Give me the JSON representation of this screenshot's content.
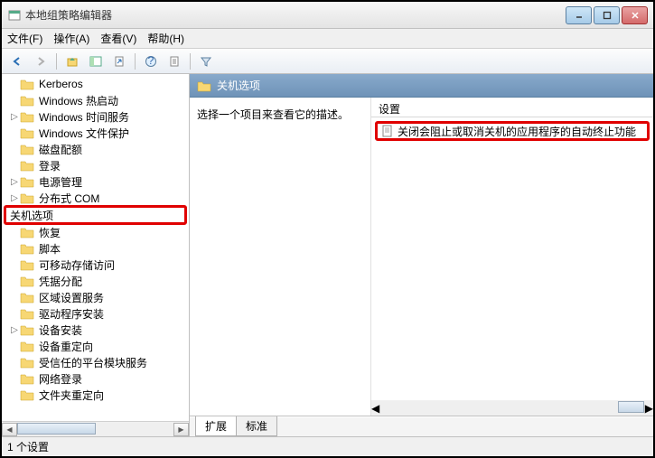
{
  "window": {
    "title": "本地组策略编辑器"
  },
  "menu": {
    "file": "文件(F)",
    "action": "操作(A)",
    "view": "查看(V)",
    "help": "帮助(H)"
  },
  "tree": {
    "items": [
      {
        "label": "Kerberos",
        "exp": ""
      },
      {
        "label": "Windows 热启动",
        "exp": ""
      },
      {
        "label": "Windows 时间服务",
        "exp": "▷"
      },
      {
        "label": "Windows 文件保护",
        "exp": ""
      },
      {
        "label": "磁盘配额",
        "exp": ""
      },
      {
        "label": "登录",
        "exp": ""
      },
      {
        "label": "电源管理",
        "exp": "▷"
      },
      {
        "label": "分布式 COM",
        "exp": "▷"
      },
      {
        "label": "关机选项",
        "exp": "",
        "selected": true
      },
      {
        "label": "恢复",
        "exp": ""
      },
      {
        "label": "脚本",
        "exp": ""
      },
      {
        "label": "可移动存储访问",
        "exp": ""
      },
      {
        "label": "凭据分配",
        "exp": ""
      },
      {
        "label": "区域设置服务",
        "exp": ""
      },
      {
        "label": "驱动程序安装",
        "exp": ""
      },
      {
        "label": "设备安装",
        "exp": "▷"
      },
      {
        "label": "设备重定向",
        "exp": ""
      },
      {
        "label": "受信任的平台模块服务",
        "exp": ""
      },
      {
        "label": "网络登录",
        "exp": ""
      },
      {
        "label": "文件夹重定向",
        "exp": ""
      }
    ]
  },
  "rightHeader": {
    "title": "关机选项"
  },
  "desc": {
    "text": "选择一个项目来查看它的描述。"
  },
  "columns": {
    "setting": "设置"
  },
  "settings": {
    "items": [
      {
        "label": "关闭会阻止或取消关机的应用程序的自动终止功能"
      }
    ]
  },
  "tabs": {
    "extended": "扩展",
    "standard": "标准"
  },
  "status": {
    "text": "1 个设置"
  }
}
